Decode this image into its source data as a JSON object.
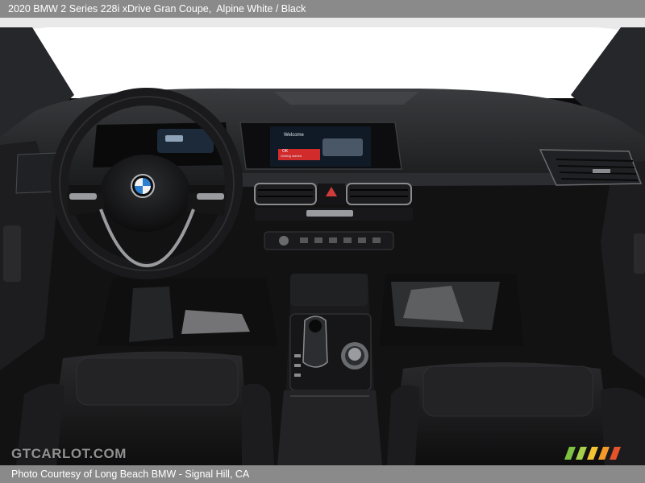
{
  "header": {
    "vehicle": "2020 BMW 2 Series 228i xDrive Gran Coupe,",
    "color": "Alpine White / Black"
  },
  "photo": {
    "screen_welcome": "Welcome",
    "screen_status": "Getting started",
    "screen_button": "OK"
  },
  "watermark": {
    "text": "GTCARLOT.COM",
    "stripe_colors": [
      "#7dc242",
      "#a6d04b",
      "#f5c332",
      "#f39a2b",
      "#e5532b"
    ]
  },
  "footer": {
    "credit": "Photo Courtesy of Long Beach BMW - Signal Hill, CA"
  }
}
